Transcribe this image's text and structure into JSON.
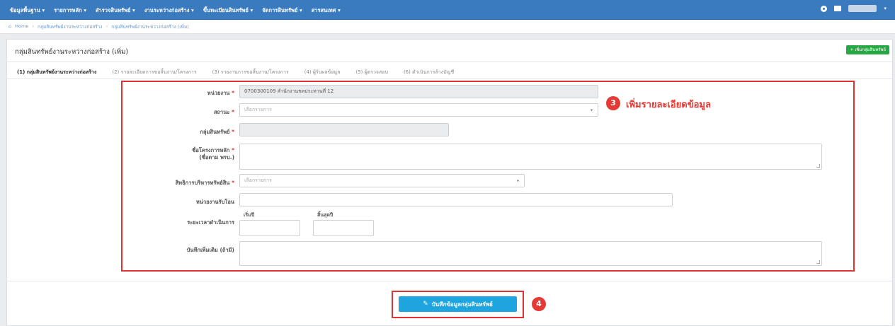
{
  "nav": {
    "menu": [
      "ข้อมูลพื้นฐาน ▾",
      "รายการหลัก ▾",
      "สำรวจสินทรัพย์ ▾",
      "งานระหว่างก่อสร้าง ▾",
      "ขึ้นทะเบียนสินทรัพย์ ▾",
      "จัดการสินทรัพย์ ▾",
      "สารสนเทศ ▾"
    ]
  },
  "breadcrumb": {
    "home": "Home",
    "items": [
      "กลุ่มสินทรัพย์งานระหว่างก่อสร้าง",
      "กลุ่มสินทรัพย์งานระหว่างก่อสร้าง (เพิ่ม)"
    ]
  },
  "panel": {
    "title": "กลุ่มสินทรัพย์งานระหว่างก่อสร้าง (เพิ่ม)",
    "add_button": "+ เพิ่มกลุ่มสินทรัพย์"
  },
  "tabs": [
    "(1) กลุ่มสินทรัพย์งานระหว่างก่อสร้าง",
    "(2) รายละเอียดการขอสิ้นงาน/โครงการ",
    "(3) รายงานการขอสิ้นงาน/โครงการ",
    "(4) ผู้รับผลข้อมูล",
    "(5) ผู้ตรวจสอบ",
    "(6) ดำเนินการล้างบัญชี"
  ],
  "form": {
    "agency": {
      "label": "หน่วยงาน",
      "value": "0700300109 สำนักงานชลประทานที่ 12"
    },
    "status": {
      "label": "สถานะ",
      "placeholder": "เลือกรายการ"
    },
    "asset_group": {
      "label": "กลุ่มสินทรัพย์",
      "value": ""
    },
    "project_name": {
      "label": "ชื่อโครงการหลัก",
      "label_sub": "(ชื่อตาม พรบ.)",
      "value": ""
    },
    "asset_right": {
      "label": "สิทธิการบริหารทรัพย์สิน",
      "placeholder": "เลือกรายการ"
    },
    "receiving_unit": {
      "label": "หน่วยงานรับโอน",
      "value": ""
    },
    "duration": {
      "label": "ระยะเวลาดำเนินการ",
      "start_label": "เริ่มปี",
      "end_label": "สิ้นสุดปี",
      "start_value": "",
      "end_value": ""
    },
    "notes": {
      "label": "บันทึกเพิ่มเติม (ถ้ามี)",
      "value": ""
    },
    "required_mark": "*"
  },
  "annotations": {
    "step3_number": "3",
    "step3_text": "เพิ่มรายละเอียดข้อมูล",
    "step4_number": "4"
  },
  "save_button": "บันทึกข้อมูลกลุ่มสินทรัพย์",
  "colors": {
    "nav": "#3a7bbf",
    "highlight": "#e23232",
    "save": "#1ea5df",
    "add": "#27a845"
  }
}
